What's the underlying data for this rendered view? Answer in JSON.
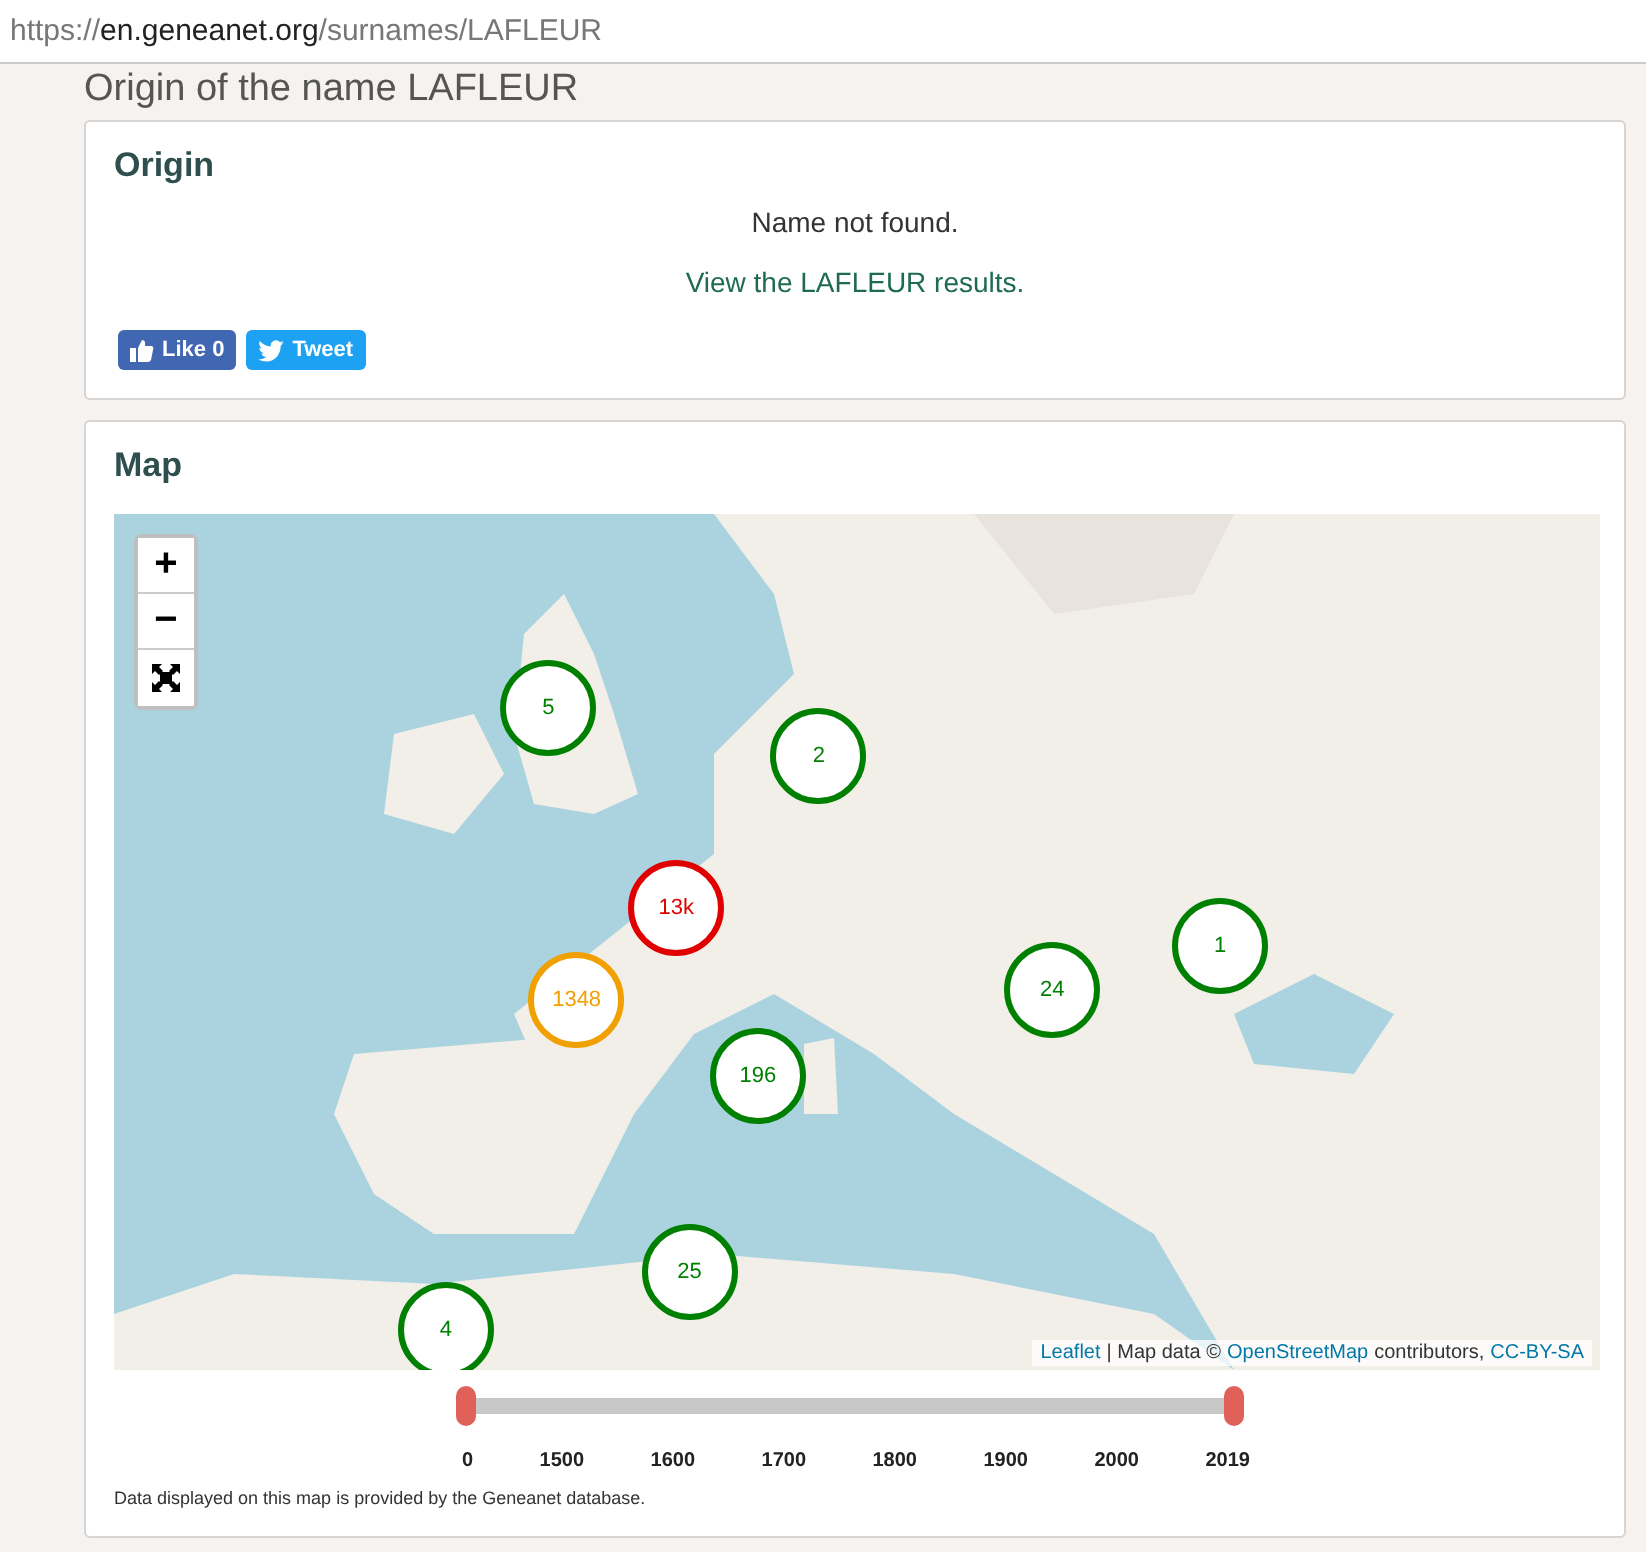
{
  "address_bar": {
    "url_prefix": "https://",
    "url_domain": "en.geneanet.org",
    "url_path": "/surnames/LAFLEUR"
  },
  "page_title": "Origin of the name LAFLEUR",
  "origin": {
    "title": "Origin",
    "message": "Name not found.",
    "link": "View the LAFLEUR results.",
    "like_button": "Like 0",
    "tweet_button": "Tweet"
  },
  "map": {
    "title": "Map",
    "zoom_in": "+",
    "zoom_out": "−",
    "markers": [
      {
        "label": "5",
        "color": "#008000"
      },
      {
        "label": "2",
        "color": "#008000"
      },
      {
        "label": "13k",
        "color": "#e00000"
      },
      {
        "label": "1348",
        "color": "#f0a000"
      },
      {
        "label": "196",
        "color": "#008000"
      },
      {
        "label": "24",
        "color": "#008000"
      },
      {
        "label": "1",
        "color": "#008000"
      },
      {
        "label": "25",
        "color": "#008000"
      },
      {
        "label": "4",
        "color": "#008000"
      }
    ],
    "attribution": {
      "leaflet": "Leaflet",
      "text_1": "| Map data ©",
      "osm": "OpenStreetMap",
      "text_2": "contributors,",
      "license": "CC-BY-SA"
    },
    "timeline": {
      "handles": [
        {
          "level": 0
        },
        {
          "level": 1
        }
      ],
      "ticks": [
        "0",
        "1500",
        "1600",
        "1700",
        "1800",
        "1900",
        "2000",
        "2019"
      ]
    },
    "note": "Data displayed on this map is provided by the Geneanet database."
  }
}
